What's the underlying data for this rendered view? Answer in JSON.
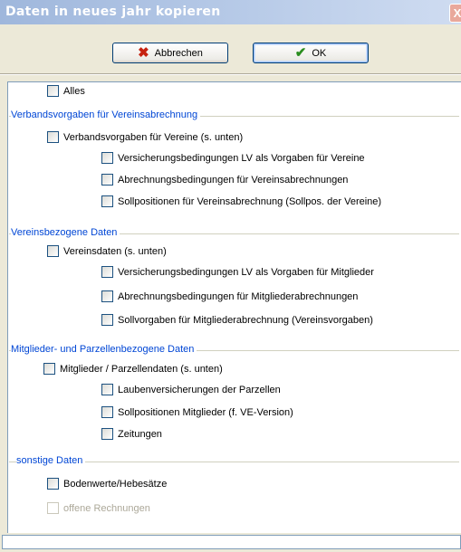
{
  "window": {
    "title": "Daten in neues jahr kopieren",
    "close_glyph": "X"
  },
  "buttons": {
    "cancel": {
      "label": "Abbrechen",
      "icon": "red-x-icon"
    },
    "ok": {
      "label": "OK",
      "icon": "green-check-icon"
    }
  },
  "options": {
    "all": {
      "label": "Alles",
      "checked": false
    }
  },
  "groups": {
    "verband": {
      "title": "Verbandsvorgaben für Vereinsabrechnung",
      "main": "Verbandsvorgaben für Vereine (s. unten)",
      "items": [
        "Versicherungsbedingungen LV als Vorgaben für Vereine",
        "Abrechnungsbedingungen für Vereinsabrechnungen",
        "Sollpositionen für Vereinsabrechnung (Sollpos. der Vereine)"
      ]
    },
    "verein": {
      "title": "Vereinsbezogene Daten",
      "main": "Vereinsdaten (s. unten)",
      "items": [
        "Versicherungsbedingungen LV als Vorgaben für Mitglieder",
        "Abrechnungsbedingungen für Mitgliederabrechnungen",
        "Sollvorgaben für Mitgliederabrechnung (Vereinsvorgaben)"
      ]
    },
    "mitglieder": {
      "title": "Mitglieder- und Parzellenbezogene Daten",
      "main": "Mitglieder / Parzellendaten (s. unten)",
      "items": [
        "Laubenversicherungen der Parzellen",
        "Sollpositionen Mitglieder (f. VE-Version)",
        "Zeitungen"
      ]
    },
    "sonstige": {
      "title": "sonstige Daten",
      "items": [
        "Bodenwerte/Hebesätze",
        "offene Rechnungen"
      ]
    }
  }
}
